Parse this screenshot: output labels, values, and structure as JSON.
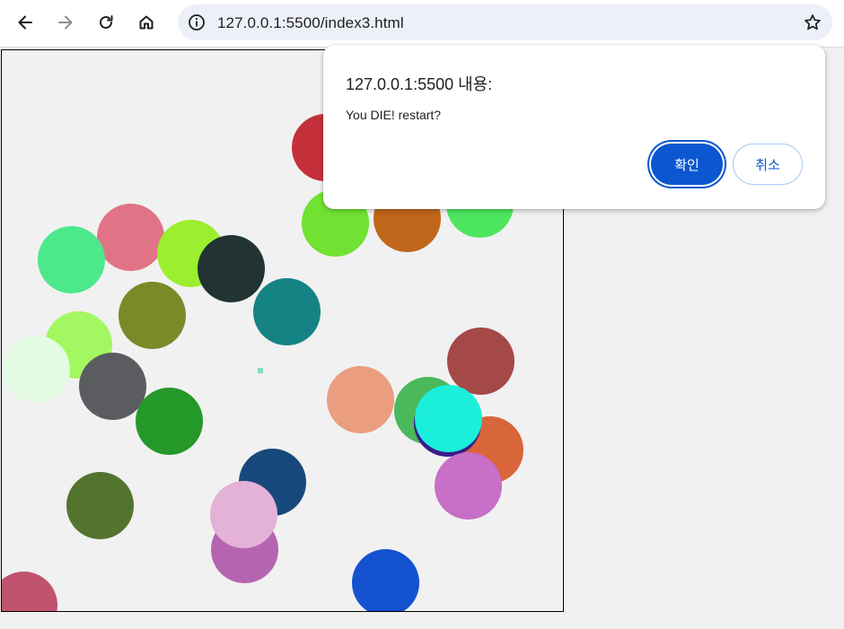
{
  "browser": {
    "url": "127.0.0.1:5500/index3.html",
    "back_icon": "arrow-left-icon",
    "forward_icon": "arrow-right-icon",
    "reload_icon": "reload-icon",
    "home_icon": "home-icon",
    "site_info_icon": "info-icon",
    "bookmark_icon": "star-icon"
  },
  "dialog": {
    "title": "127.0.0.1:5500 내용:",
    "message": "You DIE! restart?",
    "ok_label": "확인",
    "cancel_label": "취소",
    "accent_color": "#0b57d0"
  },
  "game": {
    "player_color": "#7ee0c4",
    "ball_colors": [
      "#c4303a",
      "#e07385",
      "#4de88c",
      "#9bef2e",
      "#223333",
      "#71e232",
      "#c0661a",
      "#4ee660",
      "#158383",
      "#7b8a28",
      "#a3f760",
      "#e2fbe2",
      "#5a5c60",
      "#25982a",
      "#a54848",
      "#eb9d7f",
      "#4cb85c",
      "#d9653a",
      "#3a1a8c",
      "#1ceedc",
      "#c86fc7",
      "#18497c",
      "#53742e",
      "#b565b0",
      "#e4b1d7",
      "#c0546f",
      "#1452cf"
    ]
  }
}
